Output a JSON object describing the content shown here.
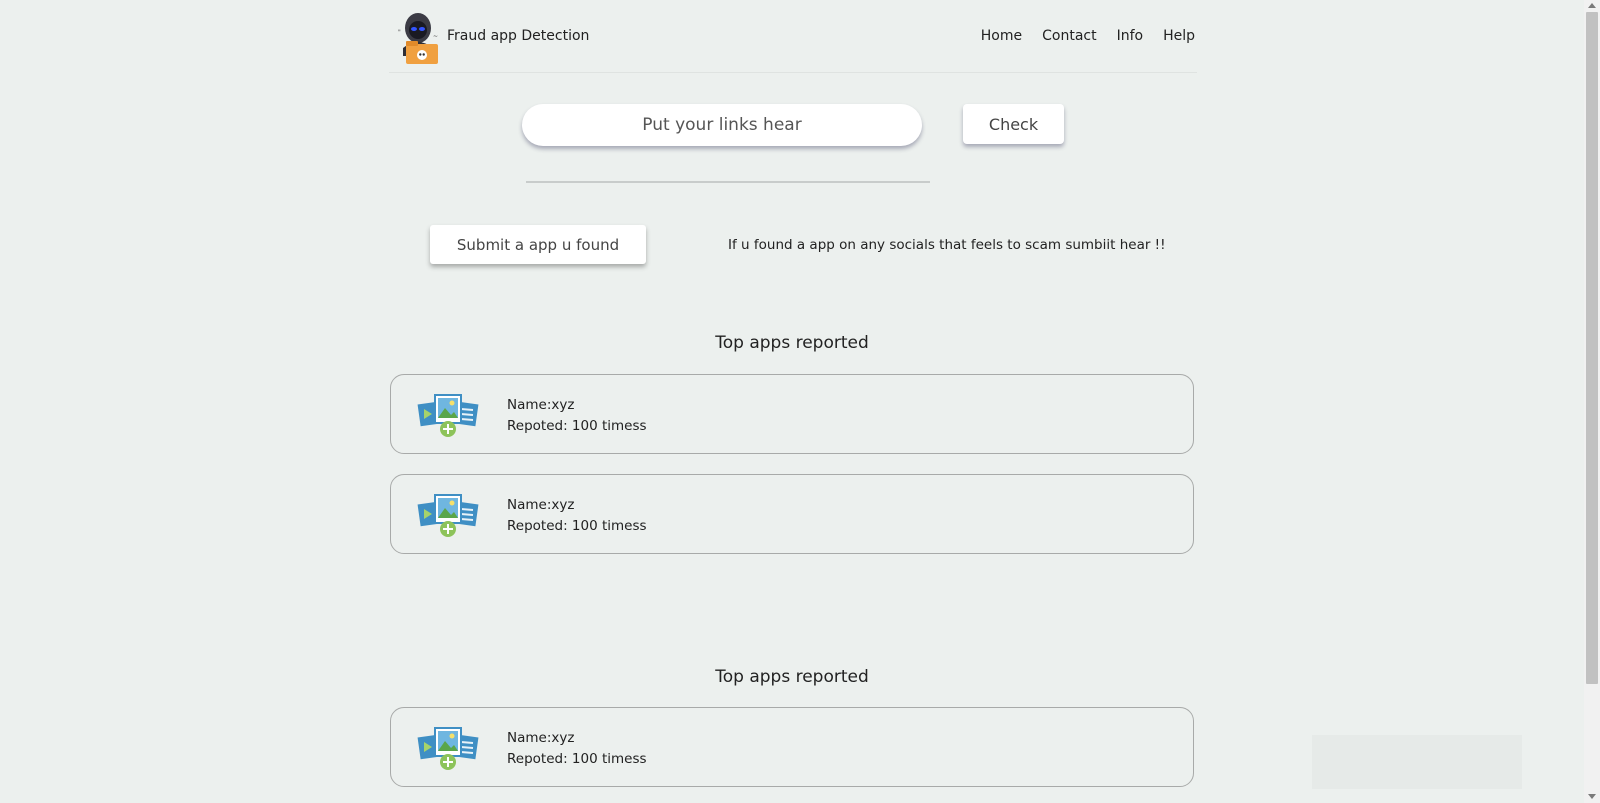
{
  "header": {
    "brand": "Fraud app Detection",
    "nav": [
      "Home",
      "Contact",
      "Info",
      "Help"
    ]
  },
  "search": {
    "placeholder": "Put your links hear",
    "check_label": "Check"
  },
  "submit": {
    "button_label": "Submit a app u found",
    "hint": "If u found a app on any socials that feels to scam sumbiit hear !!"
  },
  "sections": [
    {
      "title": "Top apps reported",
      "apps": [
        {
          "name": "Name:xyz",
          "reported": "Repoted: 100 timess",
          "icon": "media-gallery-add-icon"
        },
        {
          "name": "Name:xyz",
          "reported": "Repoted: 100 timess",
          "icon": "media-gallery-add-icon"
        }
      ]
    },
    {
      "title": "Top apps reported",
      "apps": [
        {
          "name": "Name:xyz",
          "reported": "Repoted: 100 timess",
          "icon": "media-gallery-add-icon"
        }
      ]
    }
  ],
  "colors": {
    "background": "#ecf0ee",
    "card_border": "#a8aaa9",
    "logo_folder": "#f0a040"
  }
}
